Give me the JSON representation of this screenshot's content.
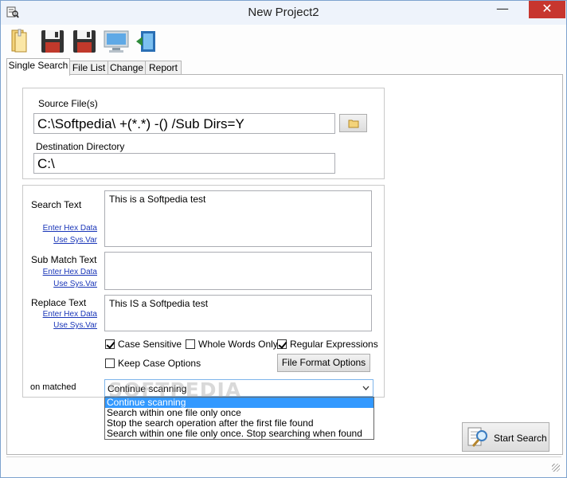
{
  "window": {
    "title": "New Project2",
    "minimize_glyph": "—",
    "close_glyph": "✕"
  },
  "toolbar": {
    "icons": [
      "open-folder-icon",
      "save-icon",
      "save-as-icon",
      "monitor-icon",
      "exit-icon"
    ]
  },
  "tabs": [
    {
      "label": "Single Search",
      "active": true
    },
    {
      "label": "File List",
      "active": false
    },
    {
      "label": "Change",
      "active": false
    },
    {
      "label": "Report",
      "active": false
    }
  ],
  "source": {
    "label": "Source File(s)",
    "value": "C:\\Softpedia\\ +(*.*) -() /Sub Dirs=Y"
  },
  "destination": {
    "label": "Destination Directory",
    "value": "C:\\"
  },
  "search": {
    "label": "Search Text",
    "hex_link": "Enter Hex Data",
    "sysvar_link": "Use Sys.Var",
    "value": "This is a Softpedia test"
  },
  "submatch": {
    "label": "Sub Match Text",
    "hex_link": "Enter Hex Data",
    "sysvar_link": "Use Sys.Var",
    "value": ""
  },
  "replace": {
    "label": "Replace Text",
    "hex_link": "Enter Hex Data",
    "sysvar_link": "Use Sys.Var",
    "value": "This IS a Softpedia test"
  },
  "options": {
    "case_sensitive": {
      "label": "Case Sensitive",
      "checked": true
    },
    "whole_words": {
      "label": "Whole Words Only",
      "checked": false
    },
    "regex": {
      "label": "Regular Expressions",
      "checked": true
    },
    "keep_case": {
      "label": "Keep Case Options",
      "checked": false
    },
    "file_format_button": "File Format Options"
  },
  "on_matched": {
    "label": "on matched",
    "selected": "Continue scanning",
    "options": [
      "Continue scanning",
      "Search within one file only once",
      "Stop the search operation after the first file found",
      "Search within one file only once. Stop searching when found"
    ]
  },
  "start_button": "Start Search",
  "watermark": "SOFTPEDIA",
  "colors": {
    "accent": "#3399ff",
    "link": "#1a36b8",
    "close": "#c7362e"
  }
}
